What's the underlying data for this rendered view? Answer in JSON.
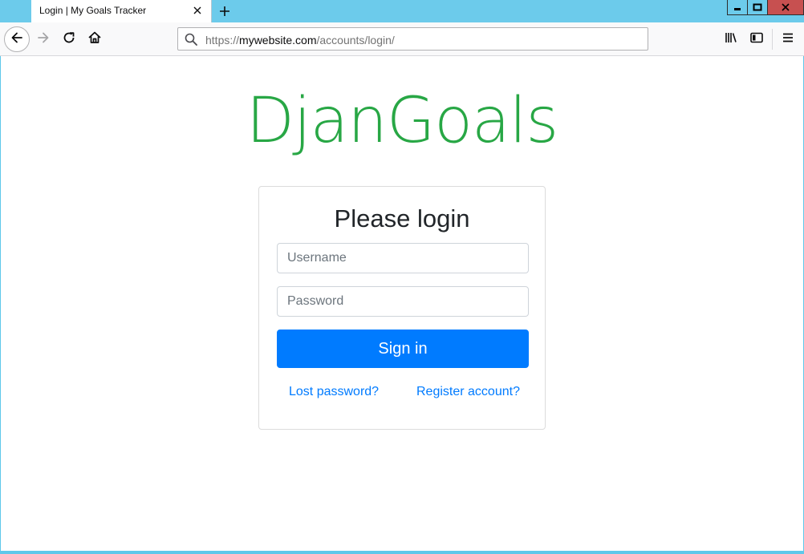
{
  "browser": {
    "tab": {
      "title": "Login | My Goals Tracker"
    },
    "url": {
      "prefix": "https://",
      "host": "mywebsite.com",
      "path": "/accounts/login/"
    },
    "icons": {
      "back": "arrow-left-icon",
      "forward": "arrow-right-icon",
      "reload": "reload-icon",
      "home": "home-icon",
      "search": "search-icon",
      "library": "library-icon",
      "sidebar": "sidebar-icon",
      "menu": "hamburger-menu-icon",
      "close_tab": "close-icon",
      "new_tab": "plus-icon"
    },
    "window_controls": [
      "minimize",
      "maximize",
      "close"
    ]
  },
  "page": {
    "brand": "DjanGoals",
    "brand_color": "#28a745",
    "login": {
      "title": "Please login",
      "username_placeholder": "Username",
      "password_placeholder": "Password",
      "submit_label": "Sign in",
      "lost_password_link": "Lost password?",
      "register_link": "Register account?"
    },
    "accent_color": "#007bff"
  }
}
